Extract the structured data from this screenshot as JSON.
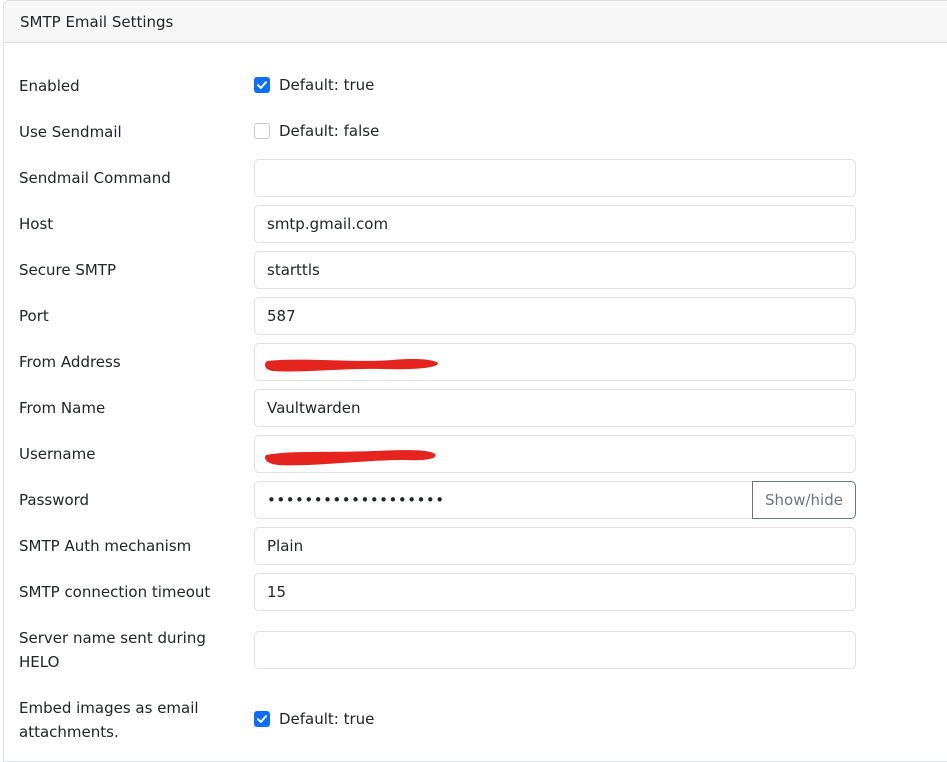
{
  "header": {
    "title": "SMTP Email Settings"
  },
  "fields": {
    "enabled": {
      "label": "Enabled",
      "checked": true,
      "default_text": "Default: true"
    },
    "use_sendmail": {
      "label": "Use Sendmail",
      "checked": false,
      "default_text": "Default: false"
    },
    "sendmail_command": {
      "label": "Sendmail Command",
      "value": ""
    },
    "host": {
      "label": "Host",
      "value": "smtp.gmail.com"
    },
    "secure_smtp": {
      "label": "Secure SMTP",
      "value": "starttls"
    },
    "port": {
      "label": "Port",
      "value": "587"
    },
    "from_address": {
      "label": "From Address",
      "value": ""
    },
    "from_name": {
      "label": "From Name",
      "value": "Vaultwarden"
    },
    "username": {
      "label": "Username",
      "value": ""
    },
    "password": {
      "label": "Password",
      "value": "•••••••••••••••••••",
      "toggle_label": "Show/hide"
    },
    "auth_mechanism": {
      "label": "SMTP Auth mechanism",
      "value": "Plain"
    },
    "timeout": {
      "label": "SMTP connection timeout",
      "value": "15"
    },
    "helo_name": {
      "label_line1": "Server name sent during",
      "label_line2": "HELO",
      "value": ""
    },
    "embed_images": {
      "label_line1": "Embed images as email",
      "label_line2": "attachments.",
      "checked": true,
      "default_text": "Default: true"
    }
  },
  "colors": {
    "accent": "#0d6efd",
    "redaction": "#e5231f"
  }
}
